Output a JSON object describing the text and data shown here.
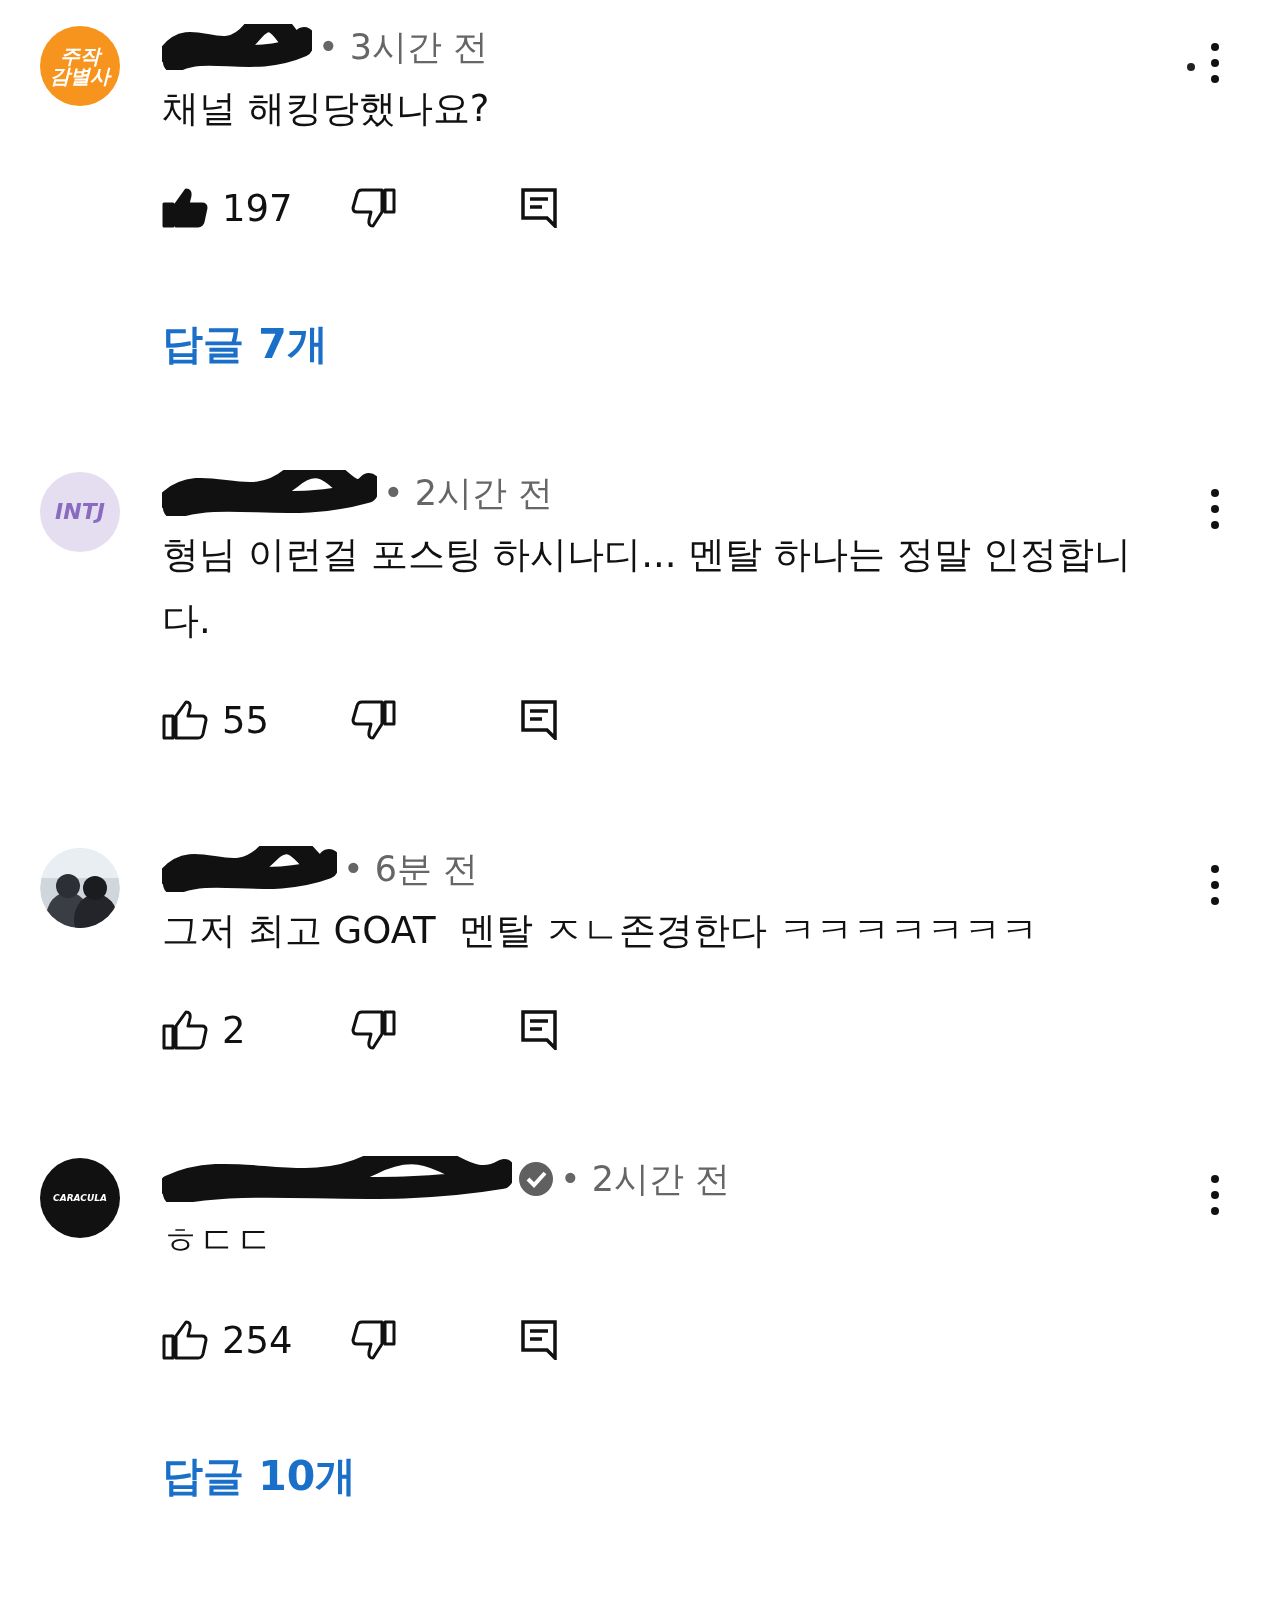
{
  "comments": [
    {
      "avatar": {
        "kind": "text",
        "lines": [
          "주작",
          "감별사"
        ]
      },
      "verified": false,
      "time": "• 3시간 전",
      "text": "채널 해킹당했나요?",
      "liked": true,
      "likes": "197",
      "unread": true,
      "replies": "답글 7개"
    },
    {
      "avatar": {
        "kind": "text",
        "lines": [
          "INTJ"
        ]
      },
      "verified": false,
      "time": "• 2시간 전",
      "text": "형님 이런걸 포스팅 하시나디... 멘탈 하나는 정말 인정합니다.",
      "liked": false,
      "likes": "55",
      "unread": false
    },
    {
      "verified": false,
      "time": "• 6분 전",
      "text": "그저 최고 GOAT  멘탈 ㅈㄴ존경한다 ㅋㅋㅋㅋㅋㅋㅋ",
      "liked": false,
      "likes": "2",
      "unread": false
    },
    {
      "avatar": {
        "kind": "text",
        "lines": [
          "CARACULA"
        ]
      },
      "verified": true,
      "time": "• 2시간 전",
      "text": "ㅎㄷㄷ",
      "liked": false,
      "likes": "254",
      "unread": false,
      "replies": "답글 10개"
    }
  ]
}
